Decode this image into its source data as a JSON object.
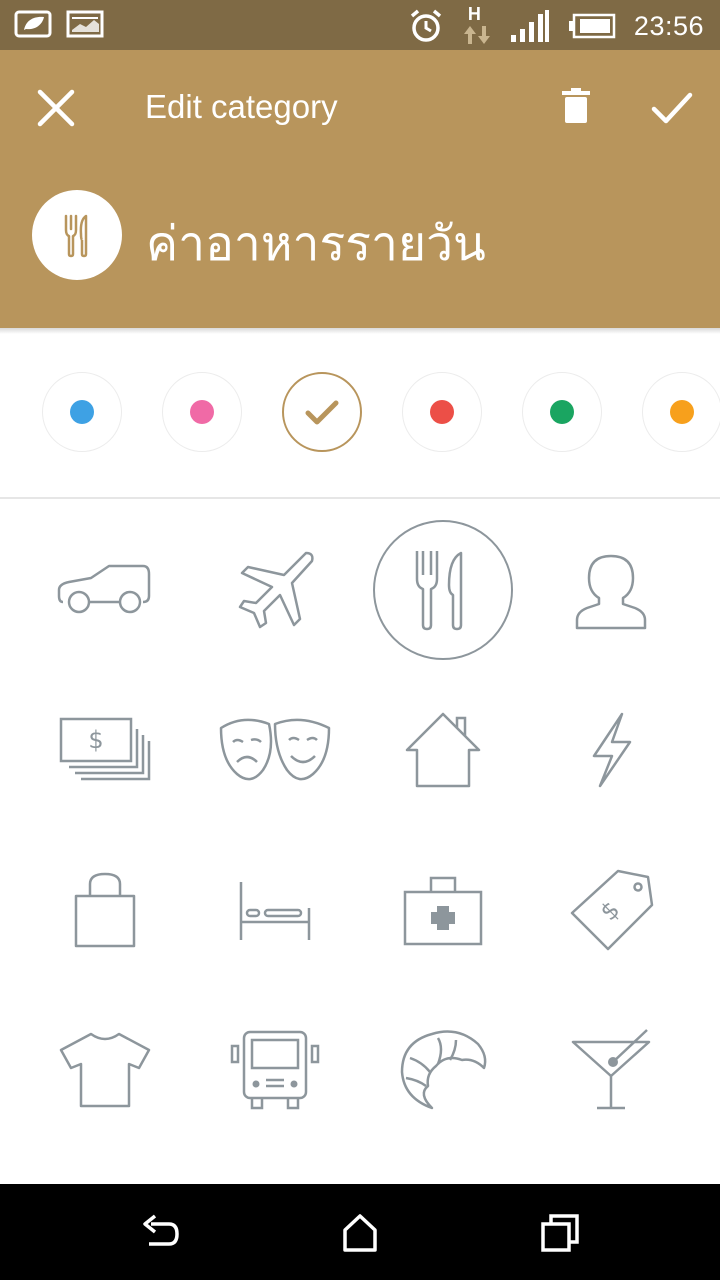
{
  "status_bar": {
    "time": "23:56",
    "network_label": "H",
    "icons": [
      "leaf-notification-icon",
      "image-notification-icon",
      "alarm-icon",
      "network-h-icon",
      "signal-icon",
      "battery-icon"
    ]
  },
  "app_bar": {
    "title": "Edit category",
    "category_name": "ค่าอาหารรายวัน",
    "category_icon": "fork-knife-icon",
    "background_color": "#b8955c",
    "icons": [
      "close-icon",
      "delete-icon",
      "done-check-icon"
    ]
  },
  "colors": {
    "swatches": [
      {
        "color": "#3ea1e4",
        "selected": false
      },
      {
        "color": "#f06aa6",
        "selected": false
      },
      {
        "color": "#b8955c",
        "selected": true
      },
      {
        "color": "#ec4f47",
        "selected": false
      },
      {
        "color": "#1aa561",
        "selected": false
      },
      {
        "color": "#f7a01c",
        "selected": false
      }
    ]
  },
  "icon_grid": {
    "icons": [
      "car-icon",
      "airplane-icon",
      "fork-knife-icon",
      "person-icon",
      "money-icon",
      "theater-masks-icon",
      "house-icon",
      "lightning-icon",
      "shopping-bag-icon",
      "bed-icon",
      "first-aid-kit-icon",
      "price-tag-icon",
      "tshirt-icon",
      "bus-icon",
      "croissant-icon",
      "cocktail-icon"
    ],
    "selected": "fork-knife-icon",
    "stroke_color": "#8d969c"
  },
  "nav_bar": {
    "icons": [
      "back-icon",
      "home-icon",
      "recents-icon"
    ]
  }
}
